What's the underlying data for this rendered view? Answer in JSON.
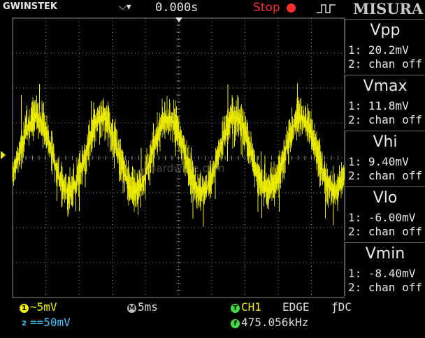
{
  "header": {
    "brand": "GWINSTEK",
    "trigger_mode_icon": "trigger-position-icon",
    "horizontal_position": "0.000s",
    "run_state": "Stop",
    "trigger_slope_icon": "rising-edge-icon",
    "menu_title": "MISURA"
  },
  "measurements": [
    {
      "name": "Vpp",
      "ch1": "1: 20.2mV",
      "ch2": "2: chan off"
    },
    {
      "name": "Vmax",
      "ch1": "1: 11.8mV",
      "ch2": "2: chan off"
    },
    {
      "name": "Vhi",
      "ch1": "1: 9.40mV",
      "ch2": "2: chan off"
    },
    {
      "name": "Vlo",
      "ch1": "1: -6.00mV",
      "ch2": "2: chan off"
    },
    {
      "name": "Vmin",
      "ch1": "1: -8.40mV",
      "ch2": "2: chan off"
    }
  ],
  "status": {
    "ch1_badge": "1",
    "ch1_scale": "~5mV",
    "ch2_badge": "2",
    "ch2_scale": "==50mV",
    "timebase_badge": "M",
    "timebase": "5ms",
    "trigger_badge": "T",
    "trigger_source": "CH1",
    "trigger_type": "EDGE",
    "trigger_coupling": "ƒDC",
    "freq_badge": "f",
    "frequency": "475.056kHz"
  },
  "screen": {
    "ch1_marker": "1",
    "watermark": "hardware.com",
    "trace_color": "#f0f000",
    "grid_color": "#8a8a8a",
    "ch2_color": "#40c8ff",
    "stop_color": "#ff2a2a"
  },
  "waveform": {
    "cycles_on_screen": 5,
    "amplitude_div": 1.05,
    "noise_div": 0.55,
    "center_div_from_top": 3.9
  }
}
